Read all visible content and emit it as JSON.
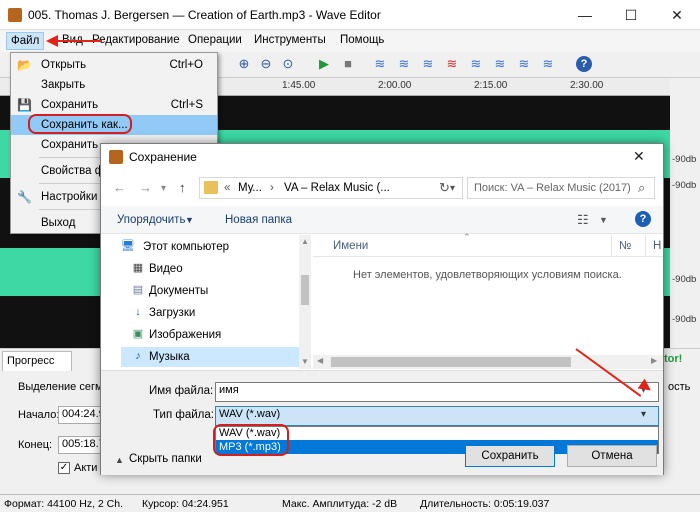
{
  "window": {
    "title": "005. Thomas J. Bergersen — Creation of Earth.mp3 - Wave Editor",
    "min": "—",
    "max": "☐",
    "close": "✕"
  },
  "menubar": {
    "file": "Файл",
    "view": "Вид",
    "edit": "Редактирование",
    "operations": "Операции",
    "tools": "Инструменты",
    "help": "Помощь"
  },
  "timeline": {
    "t1": "1:45.00",
    "t2": "2:00.00",
    "t3": "2:15.00",
    "t4": "2:30.00"
  },
  "scale": {
    "s1": "-90db",
    "s2": "-90db",
    "s3": "-90db",
    "s4": "-90db"
  },
  "file_menu": {
    "open": {
      "label": "Открыть",
      "shortcut": "Ctrl+O"
    },
    "close": {
      "label": "Закрыть"
    },
    "save": {
      "label": "Сохранить",
      "shortcut": "Ctrl+S"
    },
    "save_as": {
      "label": "Сохранить как..."
    },
    "save2": {
      "label": "Сохранить"
    },
    "props": {
      "label": "Свойства ф"
    },
    "settings": {
      "label": "Настройки"
    },
    "exit": {
      "label": "Выход"
    }
  },
  "bottom": {
    "tab_progress": "Прогресс",
    "group": "Выделение сегме",
    "start_label": "Начало:",
    "start_value": "004:24.9",
    "end_label": "Конец:",
    "end_value": "005:18.7",
    "active_label": "Акти",
    "right_tab": "tor!",
    "right_text": "ость"
  },
  "status": {
    "format": "Формат: 44100 Hz, 2 Ch.",
    "cursor": "Курсор: 04:24.951",
    "amplitude": "Макс. Амплитуда: -2 dB",
    "duration": "Длительность: 0:05:19.037"
  },
  "dialog": {
    "title": "Сохранение",
    "close": "✕",
    "path_prefix": "«",
    "path_1": "Му...",
    "path_sep": "›",
    "path_2": "VA – Relax Music (...",
    "search_placeholder": "Поиск: VA – Relax Music (2017)",
    "organize": "Упорядочить",
    "new_folder": "Новая папка",
    "tree": [
      "Этот компьютер",
      "Видео",
      "Документы",
      "Загрузки",
      "Изображения",
      "Музыка"
    ],
    "col_name": "Имени",
    "col_no": "№",
    "col_n": "Н",
    "empty": "Нет элементов, удовлетворяющих условиям поиска.",
    "filename_label": "Имя файла:",
    "filename_value": "имя",
    "filetype_label": "Тип файла:",
    "filetype_value": "WAV (*.wav)",
    "filetype_options": [
      "WAV (*.wav)",
      "MP3 (*.mp3)"
    ],
    "hide_folders": "Скрыть папки",
    "save_button": "Сохранить",
    "cancel_button": "Отмена"
  },
  "colors": {
    "wave": "#3ed8a4",
    "wave_bg": "#111111",
    "highlight": "#cce4f7",
    "selected": "#0078d7",
    "annotation": "#d21f1f"
  }
}
